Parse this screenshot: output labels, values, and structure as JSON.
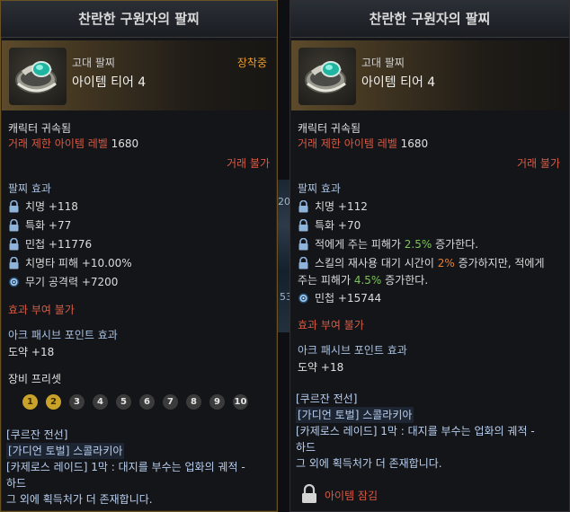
{
  "left": {
    "title": "찬란한 구원자의 팔찌",
    "tier_label": "고대 팔찌",
    "tier_value": "아이템 티어 4",
    "equipped": "장착중",
    "bound": "캐릭터 귀속됨",
    "level_label": "거래 제한 아이템 레벨",
    "level_value": "1680",
    "trade": "거래 불가",
    "effects_title": "팔찌 효과",
    "effects": [
      {
        "icon": "lock-icon",
        "text": "치명 +118"
      },
      {
        "icon": "lock-icon",
        "text": "특화 +77"
      },
      {
        "icon": "lock-icon",
        "text": "민첩 +11776"
      },
      {
        "icon": "lock-icon",
        "text": "치명타 피해 +10.00%"
      },
      {
        "icon": "swirl-icon",
        "text": "무기 공격력 +7200"
      }
    ],
    "grant": "효과 부여 불가",
    "ark_title": "아크 패시브 포인트 효과",
    "ark_value": "도약 +18",
    "preset_title": "장비 프리셋",
    "presets": [
      "1",
      "2",
      "3",
      "4",
      "5",
      "6",
      "7",
      "8",
      "9",
      "10"
    ],
    "active_presets": [
      1,
      2
    ],
    "sources": [
      "[쿠르잔 전선]",
      "[가디언 토벌] 스콜라키아",
      "[카제로스 레이드] 1막 : 대지를 부수는 업화의 궤적 -",
      "하드",
      "그 외에 획득처가 더 존재합니다."
    ]
  },
  "right": {
    "title": "찬란한 구원자의 팔찌",
    "tier_label": "고대 팔찌",
    "tier_value": "아이템 티어 4",
    "bound": "캐릭터 귀속됨",
    "level_label": "거래 제한 아이템 레벨",
    "level_value": "1680",
    "trade": "거래 불가",
    "effects_title": "팔찌 효과",
    "eff1": "치명 +112",
    "eff2": "특화 +70",
    "eff3_a": "적에게 주는 피해가 ",
    "eff3_b": "2.5%",
    "eff3_c": " 증가한다.",
    "eff4_a": "스킬의 재사용 대기 시간이 ",
    "eff4_b": "2%",
    "eff4_c": " 증가하지만, 적에게",
    "eff4_d": "주는 피해가 ",
    "eff4_e": "4.5%",
    "eff4_f": " 증가한다.",
    "eff5": "민첩 +15744",
    "grant": "효과 부여 불가",
    "ark_title": "아크 패시브 포인트 효과",
    "ark_value": "도약 +18",
    "sources": [
      "[쿠르잔 전선]",
      "[가디언 토벌] 스콜라키아",
      "[카제로스 레이드] 1막 : 대지를 부수는 업화의 궤적 -",
      "하드",
      "그 외에 획득처가 더 존재합니다."
    ],
    "locked": "아이템 잠김"
  },
  "colors": {
    "accent_gold": "#e89a2a",
    "restrict_red": "#d85a45",
    "green": "#7ec25a",
    "orange": "#e0823a"
  }
}
